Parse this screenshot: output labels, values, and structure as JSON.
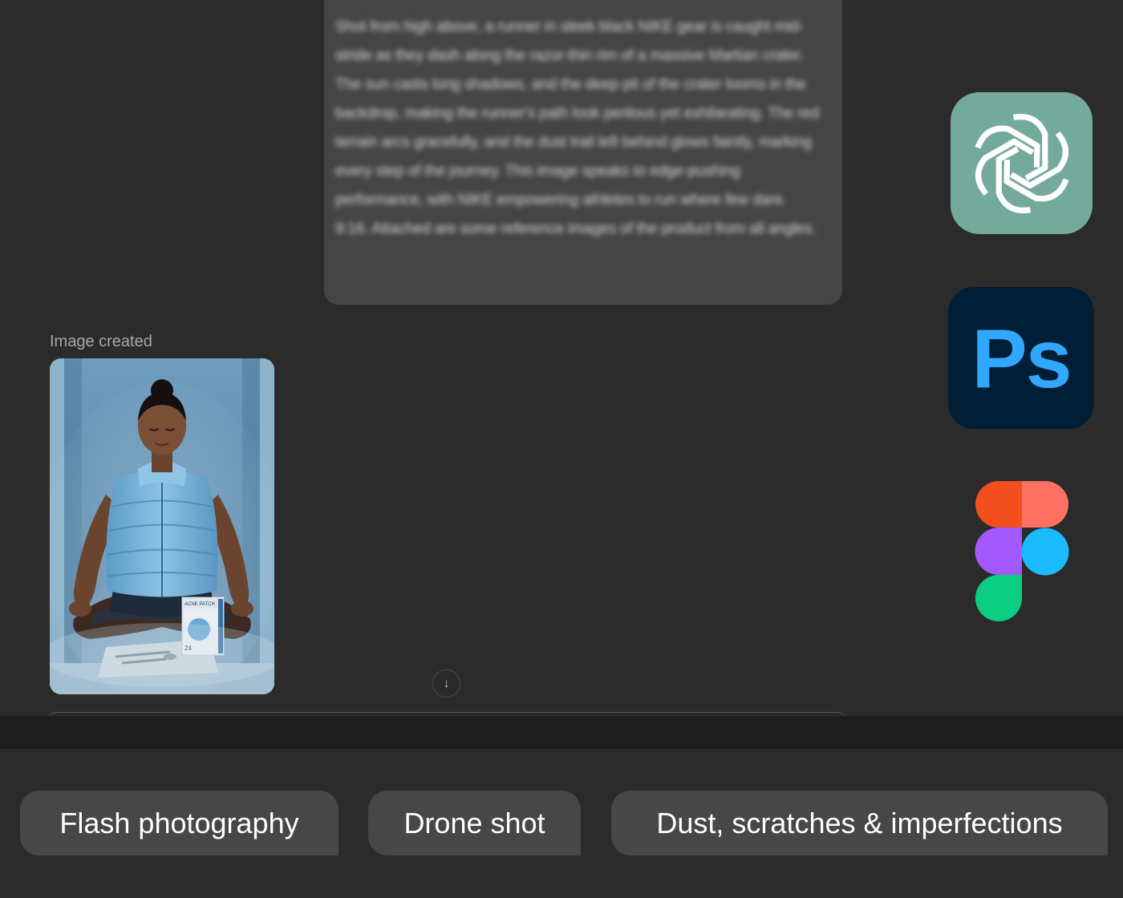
{
  "chat": {
    "prompt_text": "Shot from high above, a runner in sleek black NIKE gear is caught mid-stride as they dash along the razor-thin rim of a massive Martian crater. The sun casts long shadows, and the deep pit of the crater looms in the backdrop, making the runner's path look perilous yet exhilarating. The red terrain arcs gracefully, and the dust trail left behind glows faintly, marking every step of the journey. This image speaks to edge-pushing performance, with NIKE empowering athletes to run where few dare.\n9:16. Attached are some reference images of the product from all angles.",
    "image_created_label": "Image created",
    "product_box_text": "ACNE PATCH",
    "product_box_count": "24",
    "scroll_down_icon": "arrow-down-icon"
  },
  "apps": {
    "chatgpt_icon": "chatgpt-logo-icon",
    "photoshop_label": "Ps",
    "figma_icon": "figma-logo-icon"
  },
  "colors": {
    "background": "#2b2b2b",
    "bubble": "#454545",
    "chip": "#474747",
    "chatgpt": "#74aa9c",
    "photoshop_bg": "#001e36",
    "photoshop_fg": "#31a8ff",
    "figma_red": "#f24e1e",
    "figma_coral": "#ff7262",
    "figma_purple": "#a259ff",
    "figma_blue": "#1abcfe",
    "figma_green": "#0acf83"
  },
  "chips": [
    {
      "label": "Flash photography"
    },
    {
      "label": "Drone shot"
    },
    {
      "label": "Dust, scratches & imperfections"
    }
  ]
}
